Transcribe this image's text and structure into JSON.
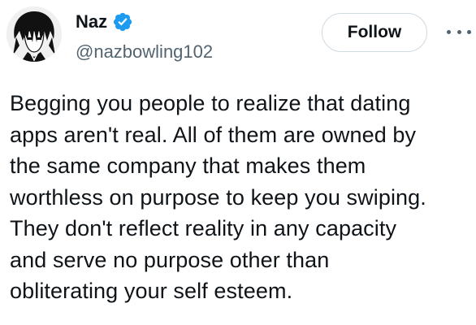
{
  "author": {
    "display_name": "Naz",
    "handle": "@nazbowling102",
    "verified": true,
    "avatar_icon": "anime-character-avatar"
  },
  "actions": {
    "follow_label": "Follow",
    "more_icon": "more-horizontal-icon"
  },
  "tweet": {
    "lines": [
      "Begging you people to realize that dating",
      "apps aren't real. All of them are owned by",
      "the same company that makes them",
      "worthless on purpose to keep you swiping.",
      "They don't reflect reality in any capacity",
      "and serve no purpose other than",
      "obliterating your self esteem."
    ]
  },
  "colors": {
    "text_primary": "#0f1419",
    "text_secondary": "#536471",
    "verified_blue": "#1d9bf0",
    "border": "#cfd9de"
  }
}
